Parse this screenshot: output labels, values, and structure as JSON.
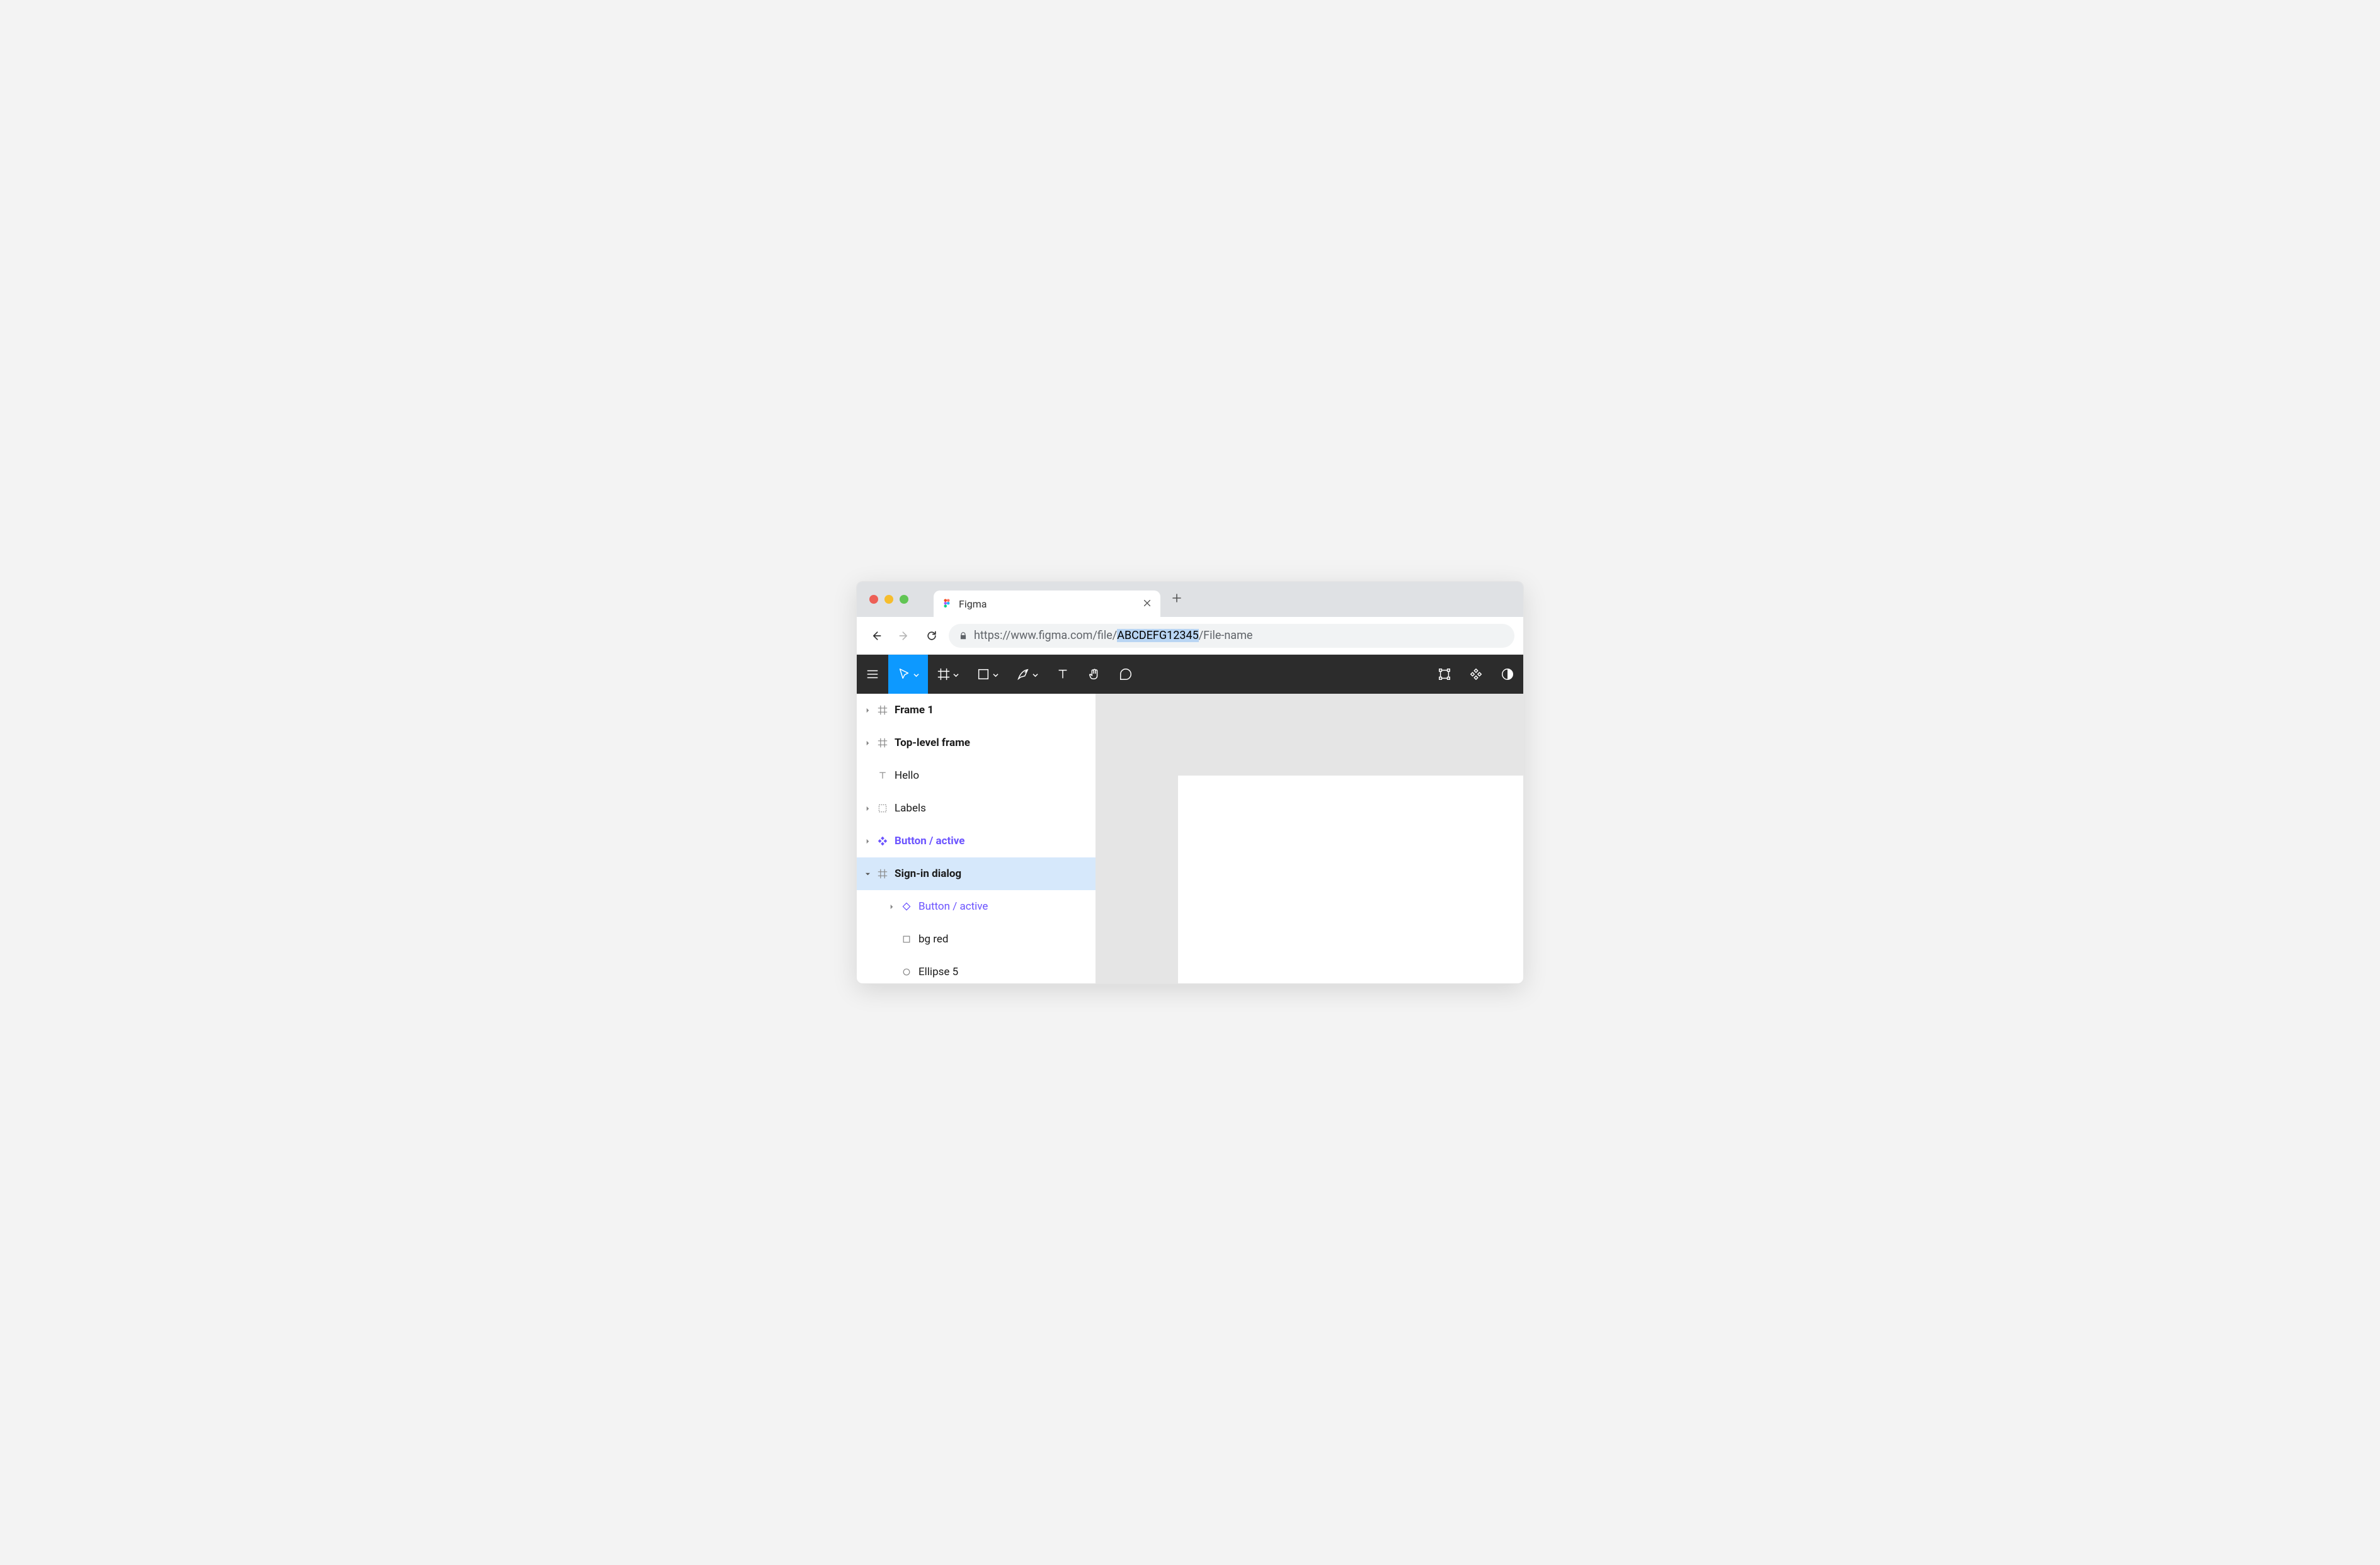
{
  "browser": {
    "tab_title": "Figma",
    "url_prefix": "https://www.figma.com/file/",
    "url_file_id": "ABCDEFG12345",
    "url_suffix": "/File-name"
  },
  "layers": [
    {
      "name": "Frame 1",
      "type": "frame",
      "bold": true,
      "depth": 0,
      "has_children": true,
      "expanded": false,
      "selected": false
    },
    {
      "name": "Top-level frame",
      "type": "frame",
      "bold": true,
      "depth": 0,
      "has_children": true,
      "expanded": false,
      "selected": false
    },
    {
      "name": "Hello",
      "type": "text",
      "bold": false,
      "depth": 0,
      "has_children": false,
      "expanded": false,
      "selected": false
    },
    {
      "name": "Labels",
      "type": "section",
      "bold": false,
      "depth": 0,
      "has_children": true,
      "expanded": false,
      "selected": false
    },
    {
      "name": "Button / active",
      "type": "component",
      "bold": true,
      "depth": 0,
      "has_children": true,
      "expanded": false,
      "selected": false
    },
    {
      "name": "Sign-in dialog",
      "type": "frame",
      "bold": true,
      "depth": 0,
      "has_children": true,
      "expanded": true,
      "selected": true
    },
    {
      "name": "Button / active",
      "type": "instance",
      "bold": false,
      "depth": 1,
      "has_children": true,
      "expanded": false,
      "selected": false
    },
    {
      "name": "bg red",
      "type": "rectangle",
      "bold": false,
      "depth": 1,
      "has_children": false,
      "expanded": false,
      "selected": false
    },
    {
      "name": "Ellipse 5",
      "type": "ellipse",
      "bold": false,
      "depth": 1,
      "has_children": false,
      "expanded": false,
      "selected": false
    }
  ],
  "colors": {
    "figma_accent": "#0d99ff",
    "component_purple": "#6b53ff",
    "selection_blue": "#d6e8fb",
    "url_highlight": "#b9d5f3"
  }
}
